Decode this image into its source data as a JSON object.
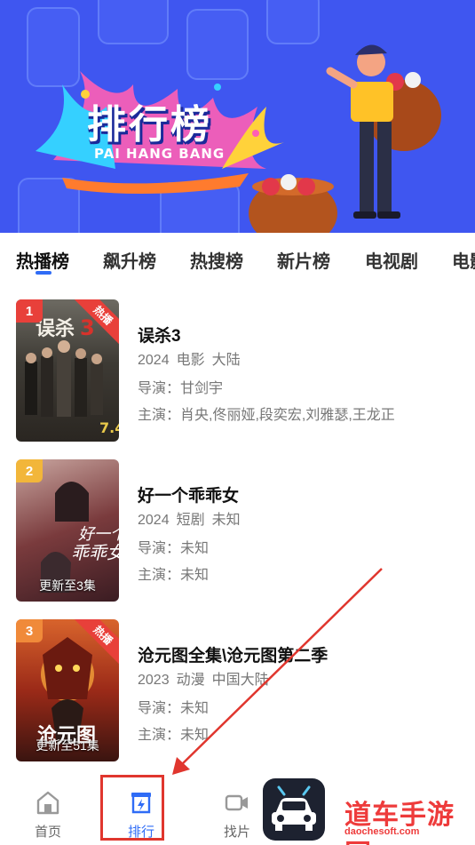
{
  "banner": {
    "title": "排行榜",
    "subtitle": "PAI HANG BANG"
  },
  "tabs": [
    {
      "label": "热播榜",
      "active": true
    },
    {
      "label": "飙升榜"
    },
    {
      "label": "热搜榜"
    },
    {
      "label": "新片榜"
    },
    {
      "label": "电视剧"
    },
    {
      "label": "电影"
    }
  ],
  "labels": {
    "director": "导演：",
    "cast": "主演："
  },
  "items": [
    {
      "rank": "1",
      "rank_color": "#e8403a",
      "hot": "热播",
      "title": "误杀3",
      "year": "2024",
      "genre": "电影",
      "region": "大陆",
      "director": "甘剑宇",
      "cast": "肖央,佟丽娅,段奕宏,刘雅瑟,王龙正",
      "poster_note": ""
    },
    {
      "rank": "2",
      "rank_color": "#f2b63a",
      "hot": "",
      "title": "好一个乖乖女",
      "year": "2024",
      "genre": "短剧",
      "region": "未知",
      "director": "未知",
      "cast": "未知",
      "poster_note": "更新至3集"
    },
    {
      "rank": "3",
      "rank_color": "#f08a3a",
      "hot": "热播",
      "title": "沧元图全集\\沧元图第二季",
      "year": "2023",
      "genre": "动漫",
      "region": "中国大陆",
      "director": "未知",
      "cast": "未知",
      "poster_note": "更新至51集"
    }
  ],
  "bottom_nav": [
    {
      "label": "首页",
      "icon": "home-icon"
    },
    {
      "label": "排行",
      "icon": "rank-icon"
    },
    {
      "label": "找片",
      "icon": "video-icon"
    }
  ],
  "watermark": {
    "text": "道车手游网",
    "sub": "daochesoft.com"
  },
  "colors": {
    "accent": "#2f6cf6",
    "banner": "#3f56f0",
    "annotation": "#e0362e"
  }
}
